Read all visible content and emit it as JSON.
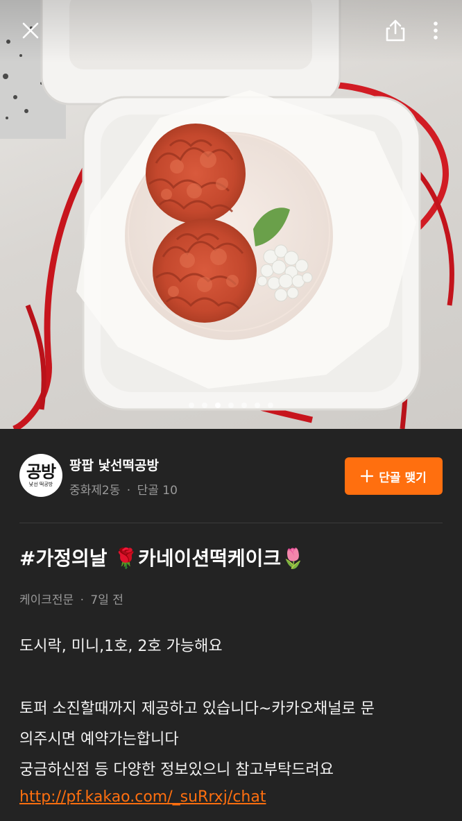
{
  "topbar": {
    "close_icon": "close-icon",
    "share_icon": "share-icon",
    "more_icon": "more-vertical-icon"
  },
  "carousel": {
    "total": 7,
    "active_index": 2
  },
  "seller": {
    "avatar_text": "공방",
    "avatar_subtext": "낯선 떡공방",
    "name": "팡팝 낯선떡공방",
    "location": "중화제2동",
    "separator": "·",
    "regulars": "단골 10",
    "follow_label": "단골 맺기",
    "follow_icon": "plus-icon"
  },
  "post": {
    "title": "#가정의날 🌹카네이션떡케이크🌷",
    "category": "케이크전문",
    "separator": "·",
    "time": "7일 전",
    "lines": [
      "도시락, 미니,1호, 2호 가능해요",
      "토퍼 소진할때까지 제공하고 있습니다~카카오채널로 문",
      "의주시면 예약가는합니다",
      "궁금하신점 등 다양한 정보있으니 참고부탁드려요"
    ],
    "link": "http://pf.kakao.com/_suRrxj/chat"
  },
  "colors": {
    "accent": "#ff6f0f",
    "background": "#232323",
    "muted": "#9a9a9a"
  }
}
